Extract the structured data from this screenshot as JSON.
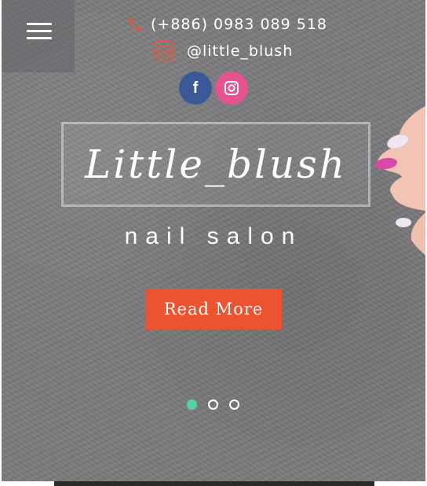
{
  "header": {
    "phone": "(+886) 0983 089 518",
    "line_id": "@little_blush",
    "line_icon_text": "LINE"
  },
  "social": [
    {
      "name": "facebook",
      "glyph": "f",
      "color": "#3b5998"
    },
    {
      "name": "instagram",
      "color": "#e6538f"
    }
  ],
  "hero": {
    "title": "Little_blush",
    "subtitle": "nail salon",
    "button_label": "Read More",
    "slides_total": 3,
    "active_slide": 1
  },
  "colors": {
    "accent": "#ec5330",
    "active_dot": "#55d5a0",
    "facebook": "#3b5998",
    "instagram": "#e6538f"
  },
  "icons": [
    "menu-icon",
    "phone-icon",
    "line-icon",
    "facebook-icon",
    "instagram-icon"
  ]
}
